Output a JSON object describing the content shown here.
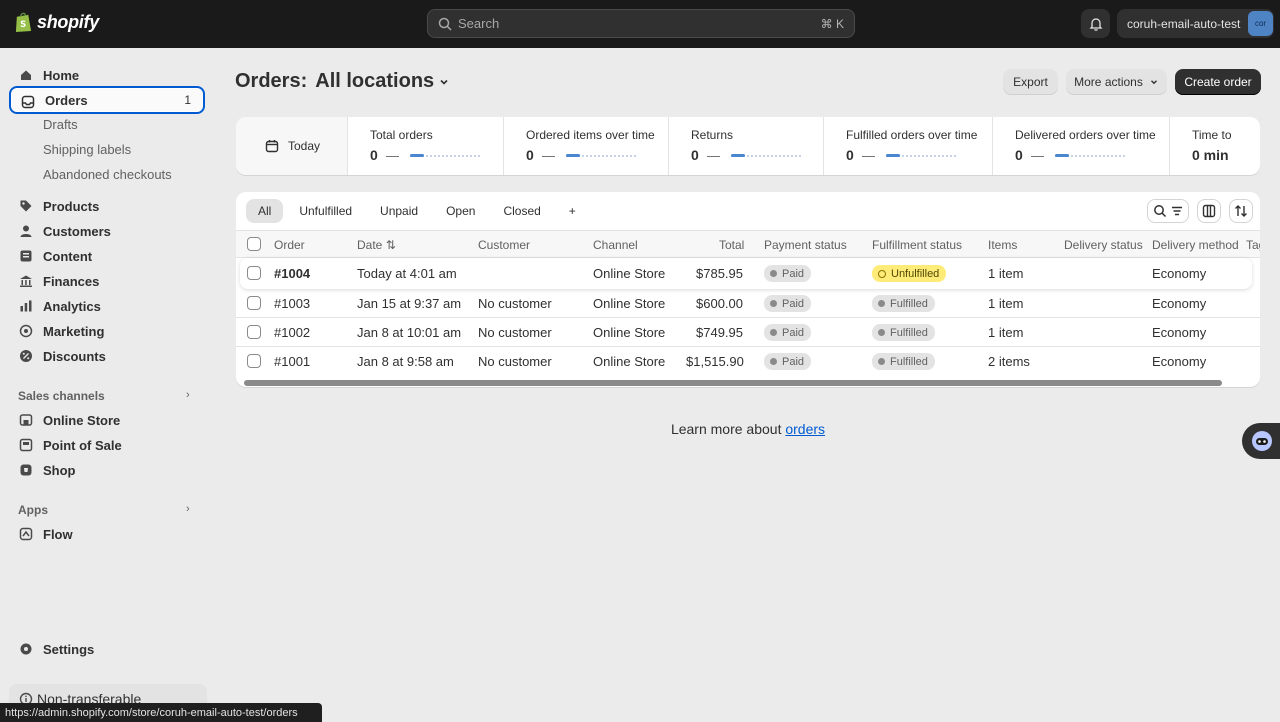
{
  "topbar": {
    "logo_text": "shopify",
    "search_placeholder": "Search",
    "search_shortcut": "⌘ K",
    "store_name": "coruh-email-auto-test",
    "store_avatar": "cor"
  },
  "sidebar": {
    "items": [
      {
        "label": "Home",
        "icon": "home-icon"
      },
      {
        "label": "Orders",
        "icon": "orders-icon",
        "count": "1",
        "active": true
      },
      {
        "label": "Products",
        "icon": "tag-icon"
      },
      {
        "label": "Customers",
        "icon": "person-icon"
      },
      {
        "label": "Content",
        "icon": "content-icon"
      },
      {
        "label": "Finances",
        "icon": "bank-icon"
      },
      {
        "label": "Analytics",
        "icon": "analytics-icon"
      },
      {
        "label": "Marketing",
        "icon": "target-icon"
      },
      {
        "label": "Discounts",
        "icon": "discount-icon"
      }
    ],
    "order_subitems": [
      "Drafts",
      "Shipping labels",
      "Abandoned checkouts"
    ],
    "sales_channels_label": "Sales channels",
    "sales_channels": [
      {
        "label": "Online Store",
        "icon": "store-icon"
      },
      {
        "label": "Point of Sale",
        "icon": "pos-icon"
      },
      {
        "label": "Shop",
        "icon": "shop-icon"
      }
    ],
    "apps_label": "Apps",
    "apps": [
      {
        "label": "Flow",
        "icon": "flow-icon"
      }
    ],
    "settings_label": "Settings",
    "nontransferable_label": "Non-transferable"
  },
  "statusbar_url": "https://admin.shopify.com/store/coruh-email-auto-test/orders",
  "page": {
    "title_prefix": "Orders:",
    "title_location": "All locations",
    "export_label": "Export",
    "more_actions_label": "More actions",
    "create_order_label": "Create order"
  },
  "metrics": {
    "period_label": "Today",
    "items": [
      {
        "label": "Total orders",
        "value": "0",
        "dash": "—"
      },
      {
        "label": "Ordered items over time",
        "value": "0",
        "dash": "—"
      },
      {
        "label": "Returns",
        "value": "0",
        "dash": "—"
      },
      {
        "label": "Fulfilled orders over time",
        "value": "0",
        "dash": "—"
      },
      {
        "label": "Delivered orders over time",
        "value": "0",
        "dash": "—"
      },
      {
        "label": "Time to",
        "value": "0 min",
        "dash": ""
      }
    ]
  },
  "table": {
    "tabs": [
      "All",
      "Unfulfilled",
      "Unpaid",
      "Open",
      "Closed",
      "+"
    ],
    "headers": {
      "order": "Order",
      "date": "Date",
      "customer": "Customer",
      "channel": "Channel",
      "total": "Total",
      "payment_status": "Payment status",
      "fulfillment_status": "Fulfillment status",
      "items": "Items",
      "delivery_status": "Delivery status",
      "delivery_method": "Delivery method",
      "tags": "Tag"
    },
    "rows": [
      {
        "order": "#1004",
        "date": "Today at 4:01 am",
        "customer": "",
        "channel": "Online Store",
        "total": "$785.95",
        "payment": "Paid",
        "fulfillment": "Unfulfilled",
        "items": "1 item",
        "delivery_status": "",
        "delivery_method": "Economy"
      },
      {
        "order": "#1003",
        "date": "Jan 15 at 9:37 am",
        "customer": "No customer",
        "channel": "Online Store",
        "total": "$600.00",
        "payment": "Paid",
        "fulfillment": "Fulfilled",
        "items": "1 item",
        "delivery_status": "",
        "delivery_method": "Economy"
      },
      {
        "order": "#1002",
        "date": "Jan 8 at 10:01 am",
        "customer": "No customer",
        "channel": "Online Store",
        "total": "$749.95",
        "payment": "Paid",
        "fulfillment": "Fulfilled",
        "items": "1 item",
        "delivery_status": "",
        "delivery_method": "Economy"
      },
      {
        "order": "#1001",
        "date": "Jan 8 at 9:58 am",
        "customer": "No customer",
        "channel": "Online Store",
        "total": "$1,515.90",
        "payment": "Paid",
        "fulfillment": "Fulfilled",
        "items": "2 items",
        "delivery_status": "",
        "delivery_method": "Economy"
      }
    ]
  },
  "learn_more": {
    "text": "Learn more about",
    "link": "orders"
  },
  "colors": {
    "topbar": "#1a1a1a",
    "accent": "#005bd3",
    "unfulfilled_badge": "#ffeb78"
  }
}
